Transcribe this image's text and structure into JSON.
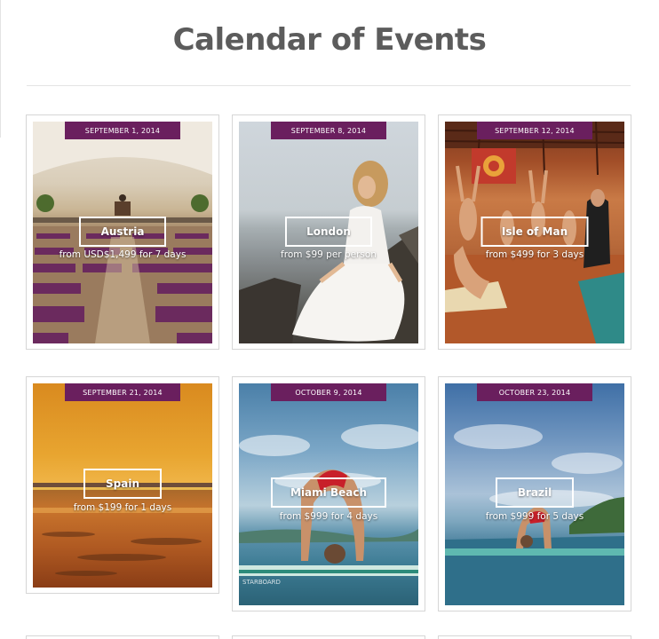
{
  "page": {
    "title": "Calendar of Events"
  },
  "events": [
    {
      "date": "SEPTEMBER 1, 2014",
      "location": "Austria",
      "price": "from USD$1,499 for 7 days"
    },
    {
      "date": "SEPTEMBER 8, 2014",
      "location": "London",
      "price": "from $99 per person"
    },
    {
      "date": "SEPTEMBER 12, 2014",
      "location": "Isle of Man",
      "price": "from $499 for 3 days"
    },
    {
      "date": "SEPTEMBER 21, 2014",
      "location": "Spain",
      "price": "from $199 for 1 days"
    },
    {
      "date": "OCTOBER 9, 2014",
      "location": "Miami Beach",
      "price": "from $999 for 4 days"
    },
    {
      "date": "OCTOBER 23, 2014",
      "location": "Brazil",
      "price": "from $999 for 5 days"
    }
  ],
  "colors": {
    "date_tab": "#6a1f5e",
    "title": "#5c5c5c",
    "card_border": "#d6d6d6"
  }
}
